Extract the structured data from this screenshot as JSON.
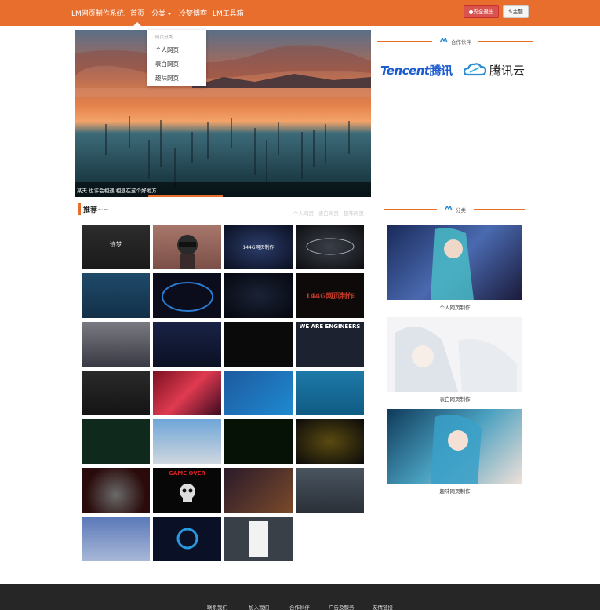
{
  "nav": {
    "brand": "LM网页制作系统.",
    "items": [
      "首页",
      "分类",
      "冷梦博客",
      "LM工具箱"
    ],
    "logout": "安全退出",
    "edit": "主题"
  },
  "dropdown": {
    "header": "网页分类",
    "items": [
      "个人网页",
      "表白网页",
      "趣味网页"
    ]
  },
  "hero": {
    "caption": "某天 也许会相遇 相遇在这个好地方"
  },
  "partners": {
    "title": "合作伙伴",
    "logos": [
      "Tencent腾讯",
      "腾讯云"
    ]
  },
  "recommend": {
    "title": "推荐~~",
    "tabs": [
      "个人网页",
      "表白网页",
      "趣味网页"
    ],
    "thumb_labels": [
      "诗梦",
      "144G网页制作",
      "144G网页制作",
      "GAME OVER",
      "WE ARE ENGINEERS"
    ]
  },
  "categories": {
    "title": "分类",
    "items": [
      "个人网页制作",
      "表白网页制作",
      "趣味网页制作"
    ]
  },
  "footer": {
    "links": [
      "联系我们",
      "加入我们",
      "合作伙伴",
      "广告及服务",
      "友情链接"
    ]
  },
  "colors": {
    "accent": "#e86e2e",
    "danger": "#d9534f",
    "footer_bg": "#262626",
    "tencent_blue": "#1b5bd0"
  }
}
